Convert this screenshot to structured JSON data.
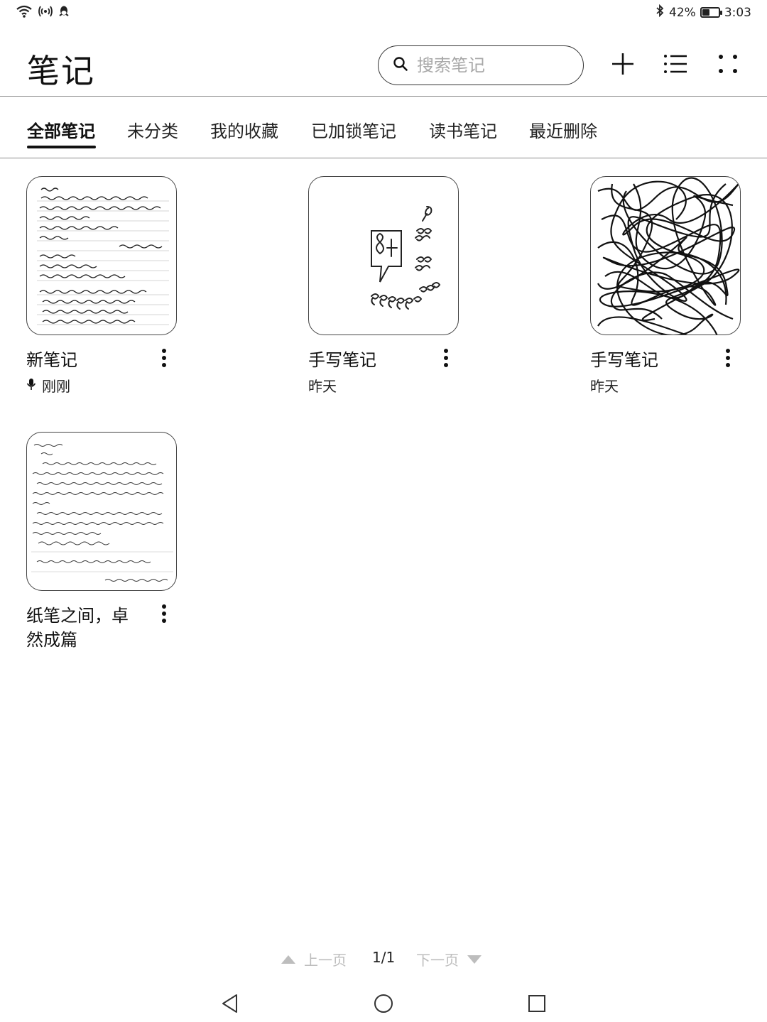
{
  "status_bar": {
    "left_icons": [
      "wifi-icon",
      "hotspot-icon",
      "qq-icon"
    ],
    "battery_percent": "42%",
    "battery_level": 0.42,
    "time": "3:03"
  },
  "header": {
    "title": "笔记",
    "search": {
      "placeholder": "搜索笔记",
      "value": ""
    },
    "actions": [
      "add-icon",
      "list-view-icon",
      "more-grid-icon"
    ]
  },
  "tabs": [
    {
      "label": "全部笔记",
      "active": true
    },
    {
      "label": "未分类",
      "active": false
    },
    {
      "label": "我的收藏",
      "active": false
    },
    {
      "label": "已加锁笔记",
      "active": false
    },
    {
      "label": "读书笔记",
      "active": false
    },
    {
      "label": "最近删除",
      "active": false
    }
  ],
  "notes": [
    {
      "title": "新笔记",
      "meta": "刚刚",
      "meta_icon": "microphone-icon",
      "thumbnail": "handwritten-text"
    },
    {
      "title": "手写笔记",
      "meta": "昨天",
      "thumbnail": "handwritten-numbers"
    },
    {
      "title": "手写笔记",
      "meta": "昨天",
      "thumbnail": "scribble"
    },
    {
      "title": "纸笔之间，卓然成篇",
      "meta": "",
      "thumbnail": "handwritten-letter"
    }
  ],
  "pager": {
    "prev_label": "上一页",
    "page_indicator": "1/1",
    "next_label": "下一页"
  },
  "nav_bar": [
    "back-icon",
    "home-icon",
    "recents-icon"
  ]
}
